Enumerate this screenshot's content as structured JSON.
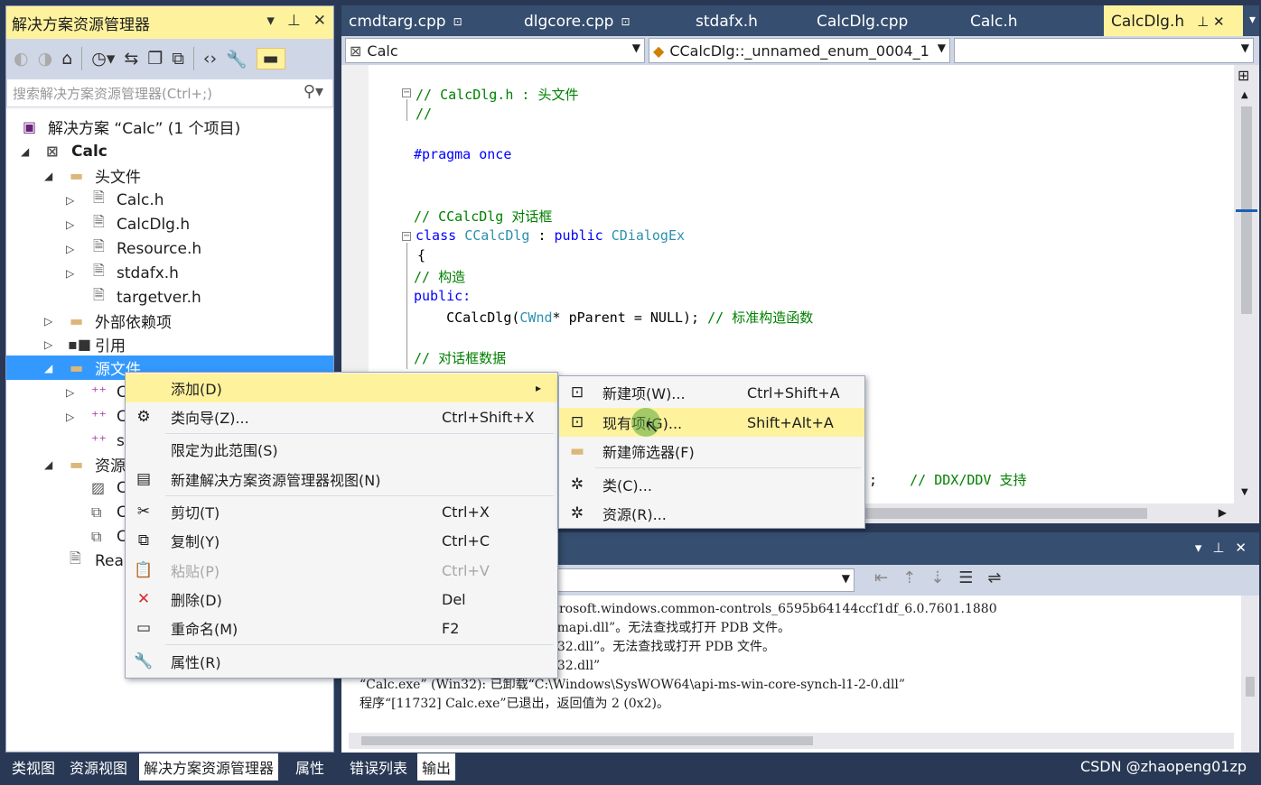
{
  "solution_explorer": {
    "title": "解决方案资源管理器",
    "title_tools": [
      "▾",
      "⊥",
      "✕"
    ],
    "toolbar_icons": [
      "back-icon",
      "forward-icon",
      "home-icon",
      "history-icon",
      "sync-icon",
      "collapse-icon",
      "copy-icon",
      "code-view-icon",
      "properties-icon",
      "preview-icon"
    ],
    "search_placeholder": "搜索解决方案资源管理器(Ctrl+;)",
    "tree": {
      "solution": "解决方案 “Calc” (1 个项目)",
      "project": "Calc",
      "header_files": "头文件",
      "header_items": [
        "Calc.h",
        "CalcDlg.h",
        "Resource.h",
        "stdafx.h",
        "targetver.h"
      ],
      "external_deps": "外部依赖项",
      "references": "引用",
      "source_files": "源文件",
      "source_items": [
        "C",
        "C",
        "s"
      ],
      "resources": "资源",
      "resource_items": [
        "C",
        "C",
        "C"
      ],
      "readme": "Rea"
    }
  },
  "bottom_tabs_left": [
    "类视图",
    "资源视图",
    "解决方案资源管理器",
    "属性"
  ],
  "bottom_tabs_right": [
    "错误列表",
    "输出"
  ],
  "doc_tabs": [
    {
      "label": "cmdtarg.cpp",
      "pin": "⊡"
    },
    {
      "label": "dlgcore.cpp",
      "pin": "⊡"
    },
    {
      "label": "stdafx.h",
      "pin": ""
    },
    {
      "label": "CalcDlg.cpp",
      "pin": ""
    },
    {
      "label": "Calc.h",
      "pin": ""
    },
    {
      "label": "CalcDlg.h",
      "pin": "⊥ ✕"
    }
  ],
  "nav": {
    "project": "Calc",
    "scope": "CCalcDlg::_unnamed_enum_0004_1",
    "member": ""
  },
  "code": {
    "l1": "// CalcDlg.h : 头文件",
    "l2": "//",
    "l3_kw": "#pragma once",
    "l4": "// CCalcDlg 对话框",
    "l5_kw": "class",
    "l5_type": "CCalcDlg",
    "l5_sep": " : ",
    "l5_kw2": "public",
    "l5_base": "CDialogEx",
    "l6": "{",
    "l7": "// 构造",
    "l8": "public:",
    "l9_a": "    CCalcDlg(",
    "l9_t": "CWnd",
    "l9_b": "* pParent = NULL); ",
    "l9_c": "// 标准构造函数",
    "l10": "// 对话框数据",
    "l11_a": ";",
    "l11_c": "// DDX/DDV 支持"
  },
  "output": {
    "lines": [
      "载“C:\\Windows\\winsxs\\x86_microsoft.windows.common-controls_6595b64144ccf1df_6.0.7601.1880",
      "载“C:\\Windows\\SysWOW64\\dwmapi.dll”。无法查找或打开 PDB 文件。",
      "载“C:\\Windows\\SysWOW64\\ole32.dll”。无法查找或打开 PDB 文件。",
      "载“C:\\Windows\\SysWOW64\\ole32.dll”",
      "“Calc.exe” (Win32): 已卸载“C:\\Windows\\SysWOW64\\api-ms-win-core-synch-l1-2-0.dll”",
      "程序“[11732] Calc.exe”已退出，返回值为 2 (0x2)。"
    ],
    "title_tools": [
      "▾",
      "⊥",
      "✕"
    ]
  },
  "context_menu": [
    {
      "label": "添加(D)",
      "key": "",
      "icon": "",
      "submenu": "▸",
      "highlight": true
    },
    {
      "label": "类向导(Z)...",
      "key": "Ctrl+Shift+X",
      "icon": "class-wizard-icon"
    },
    {
      "label": "限定为此范围(S)",
      "key": "",
      "icon": ""
    },
    {
      "label": "新建解决方案资源管理器视图(N)",
      "key": "",
      "icon": "new-view-icon"
    },
    {
      "label": "剪切(T)",
      "key": "Ctrl+X",
      "icon": "cut-icon"
    },
    {
      "label": "复制(Y)",
      "key": "Ctrl+C",
      "icon": "copy-icon"
    },
    {
      "label": "粘贴(P)",
      "key": "Ctrl+V",
      "icon": "paste-icon",
      "disabled": true
    },
    {
      "label": "删除(D)",
      "key": "Del",
      "icon": "delete-icon"
    },
    {
      "label": "重命名(M)",
      "key": "F2",
      "icon": "rename-icon"
    },
    {
      "label": "属性(R)",
      "key": "",
      "icon": "properties-icon"
    }
  ],
  "submenu": [
    {
      "label": "新建项(W)...",
      "key": "Ctrl+Shift+A",
      "icon": "new-item-icon"
    },
    {
      "label": "现有项(G)...",
      "key": "Shift+Alt+A",
      "icon": "existing-item-icon",
      "highlight": true
    },
    {
      "label": "新建筛选器(F)",
      "key": "",
      "icon": "new-filter-icon"
    },
    {
      "label": "类(C)...",
      "key": "",
      "icon": "class-icon"
    },
    {
      "label": "资源(R)...",
      "key": "",
      "icon": "resource-icon"
    }
  ],
  "watermark": "CSDN @zhaopeng01zp",
  "colors": {
    "accent_yellow": "#fff29d",
    "selection_blue": "#3399ff",
    "frame_blue": "#293955"
  }
}
